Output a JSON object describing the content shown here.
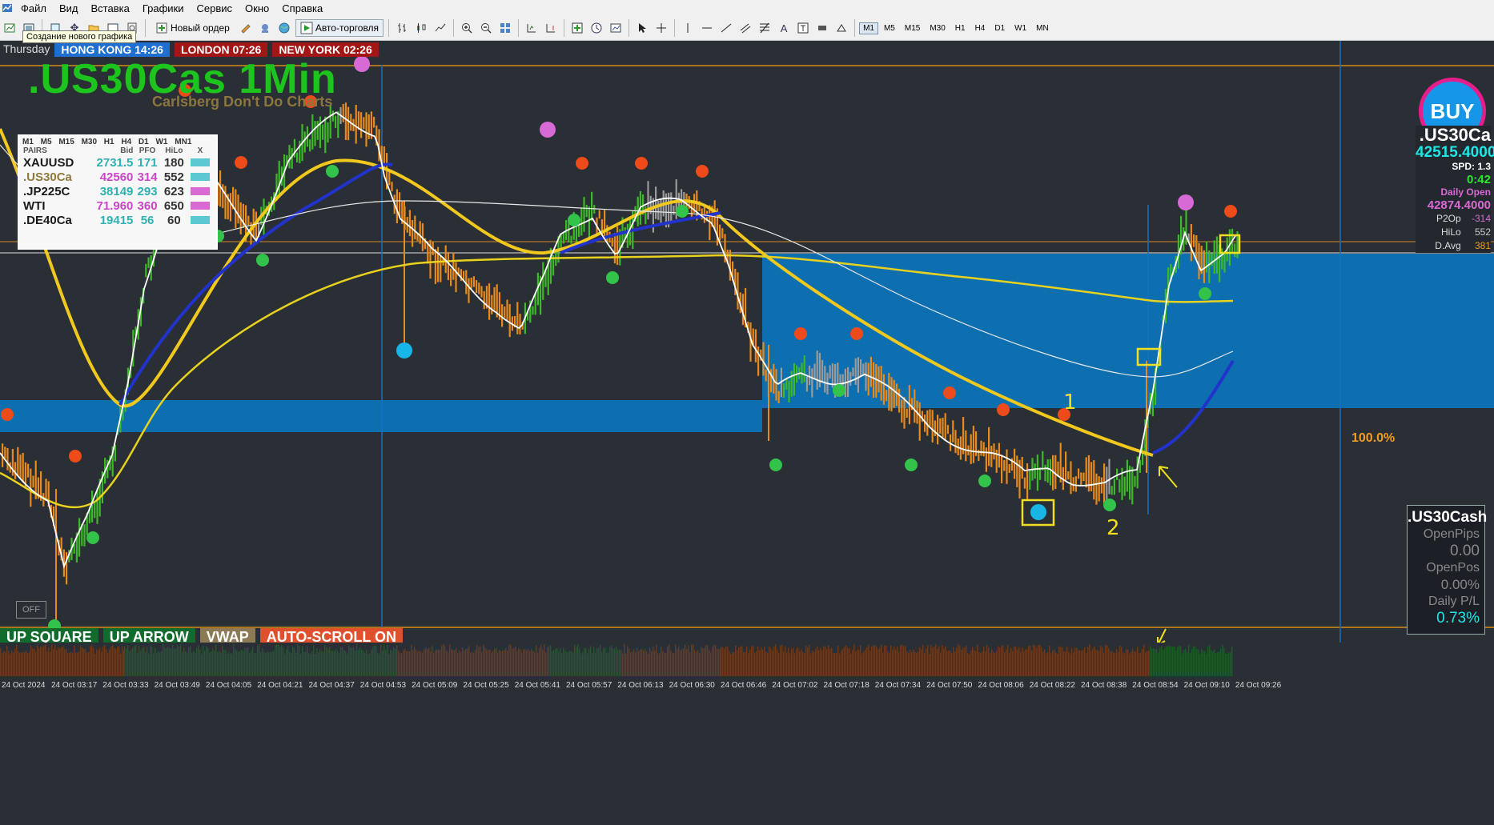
{
  "menu": [
    "Файл",
    "Вид",
    "Вставка",
    "Графики",
    "Сервис",
    "Окно",
    "Справка"
  ],
  "toolbar": {
    "new_order": "Новый ордер",
    "auto_trading": "Авто-торговля",
    "timeframes": [
      "M1",
      "M5",
      "M15",
      "M30",
      "H1",
      "H4",
      "D1",
      "W1",
      "MN"
    ],
    "active_timeframe": "M1",
    "tooltip": "Создание нового графика"
  },
  "chart": {
    "day_label": "Thursday",
    "sessions": [
      {
        "label": "HONG KONG 14:26",
        "color": "#1f6fd1"
      },
      {
        "label": "LONDON  07:26",
        "color": "#a31616"
      },
      {
        "label": "NEW YORK  02:26",
        "color": "#a31616"
      }
    ],
    "title": ".US30Cas 1Min",
    "subtitle": "Carlsberg Don't Do Charts",
    "level_label": "100.0%",
    "off_button": "OFF"
  },
  "pairs_table": {
    "timeframes": "M1 M5 M15 M30 H1 H4 D1 W1 MN1",
    "headers": [
      "PAIRS",
      "Bid",
      "PFO",
      "HiLo",
      "X"
    ],
    "rows": [
      {
        "pair": "XAUUSD",
        "bid": "2731.5",
        "pfo": "171",
        "hilo": "180",
        "pair_color": "#1a1a1a",
        "bid_color": "#2fb1b1",
        "pfo_color": "#2fb1b1",
        "swatch": "#5cc8d1"
      },
      {
        "pair": ".US30Ca",
        "bid": "42560",
        "pfo": "314",
        "hilo": "552",
        "pair_color": "#8f7a3e",
        "bid_color": "#cc44cc",
        "pfo_color": "#cc44cc",
        "swatch": "#5cc8d1"
      },
      {
        "pair": ".JP225C",
        "bid": "38149",
        "pfo": "293",
        "hilo": "623",
        "pair_color": "#1a1a1a",
        "bid_color": "#2fb1b1",
        "pfo_color": "#2fb1b1",
        "swatch": "#d96ad3"
      },
      {
        "pair": "WTI",
        "bid": "71.960",
        "pfo": "360",
        "hilo": "650",
        "pair_color": "#1a1a1a",
        "bid_color": "#cc44cc",
        "pfo_color": "#cc44cc",
        "swatch": "#d96ad3"
      },
      {
        "pair": ".DE40Ca",
        "bid": "19415",
        "pfo": "56",
        "hilo": "60",
        "pair_color": "#1a1a1a",
        "bid_color": "#2fb1b1",
        "pfo_color": "#2fb1b1",
        "swatch": "#5cc8d1"
      }
    ]
  },
  "signal_panel": {
    "buy_label": "BUY",
    "symbol": ".US30Ca",
    "price": "42515.4000",
    "spread": "SPD: 1.3",
    "timer": "0:42",
    "daily_open_label": "Daily Open",
    "daily_open": "42874.4000",
    "stats": [
      {
        "label": "P2Op",
        "value": "-314",
        "color": "#d96ad3"
      },
      {
        "label": "HiLo",
        "value": "552",
        "color": "#cccccc"
      },
      {
        "label": "D.Avg",
        "value": "381",
        "color": "#f39c1f"
      }
    ]
  },
  "position_panel": {
    "symbol": ".US30Cash",
    "open_pips_label": "OpenPips",
    "open_pips": "0.00",
    "open_pos_label": "OpenPos",
    "open_pos": "0.00%",
    "daily_pl_label": "Daily P/L",
    "daily_pl": "0.73%"
  },
  "bottom_buttons": [
    {
      "label": "UP SQUARE",
      "color": "#116b2c"
    },
    {
      "label": "UP ARROW",
      "color": "#116b2c"
    },
    {
      "label": "VWAP",
      "color": "#8c7a54"
    },
    {
      "label": "AUTO-SCROLL ON",
      "color": "#e0502c"
    }
  ],
  "annotations": [
    "1",
    "2"
  ],
  "time_labels": [
    "24 Oct 2024",
    "24 Oct 03:17",
    "24 Oct 03:33",
    "24 Oct 03:49",
    "24 Oct 04:05",
    "24 Oct 04:21",
    "24 Oct 04:37",
    "24 Oct 04:53",
    "24 Oct 05:09",
    "24 Oct 05:25",
    "24 Oct 05:41",
    "24 Oct 05:57",
    "24 Oct 06:13",
    "24 Oct 06:30",
    "24 Oct 06:46",
    "24 Oct 07:02",
    "24 Oct 07:18",
    "24 Oct 07:34",
    "24 Oct 07:50",
    "24 Oct 08:06",
    "24 Oct 08:22",
    "24 Oct 08:38",
    "24 Oct 08:54",
    "24 Oct 09:10",
    "24 Oct 09:26"
  ]
}
